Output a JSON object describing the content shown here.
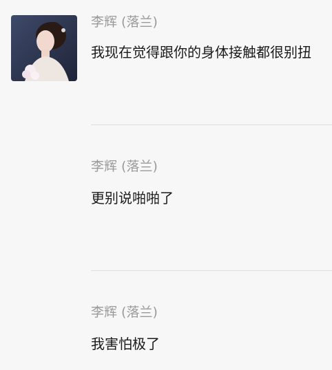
{
  "messages": [
    {
      "sender": "李辉 (落兰)",
      "text": "我现在觉得跟你的身体接触都很别扭",
      "has_avatar": true
    },
    {
      "sender": "李辉 (落兰)",
      "text": "更别说啪啪了",
      "has_avatar": false
    },
    {
      "sender": "李辉 (落兰)",
      "text": "我害怕极了",
      "has_avatar": false
    }
  ],
  "colors": {
    "background": "#f7f7f7",
    "sender": "#9a9a9a",
    "text": "#1a1a1a",
    "divider": "#dedede"
  }
}
